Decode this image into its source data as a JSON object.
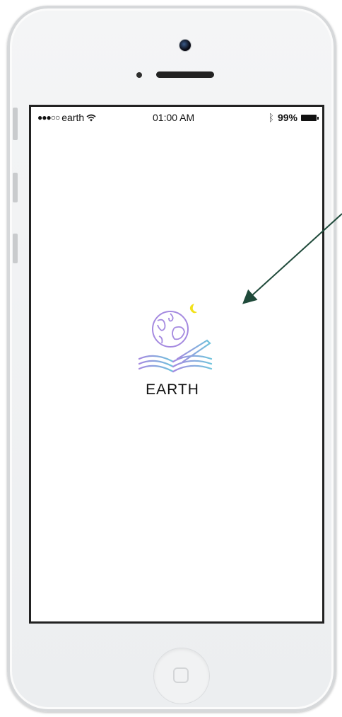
{
  "status_bar": {
    "signal": "●●●○○",
    "carrier": "earth",
    "time": "01:00 AM",
    "battery_percent": "99%",
    "bluetooth_icon": "bluetooth-icon",
    "wifi_icon": "wifi-icon"
  },
  "splash": {
    "app_name": "EARTH",
    "logo_icon": "globe-book-moon-icon"
  },
  "colors": {
    "globe": "#a58ae0",
    "moon": "#f2e11a",
    "book": "#6fc3dc",
    "arrow": "#1f4a3a"
  }
}
